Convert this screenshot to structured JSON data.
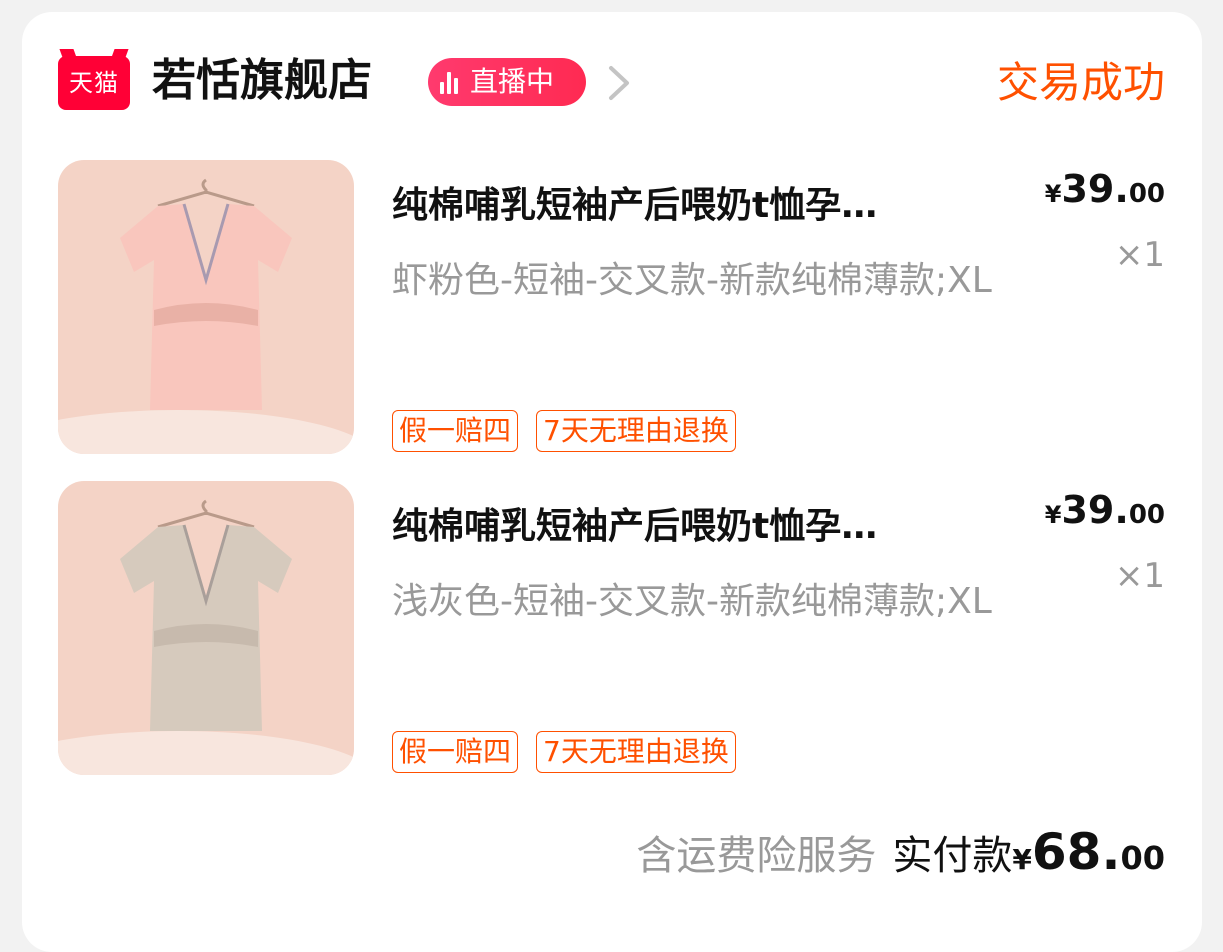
{
  "store": {
    "logo_text": "天猫",
    "name": "若恬旗舰店",
    "live_label": "直播中",
    "order_status": "交易成功"
  },
  "items": [
    {
      "title": "纯棉哺乳短袖产后喂奶t恤孕…",
      "spec": "虾粉色-短袖-交叉款-新款纯棉薄款;XL",
      "price_currency": "¥",
      "price_int": "39.",
      "price_dec": "00",
      "quantity": "×1",
      "tags": [
        "假一赔四",
        "7天无理由退换"
      ],
      "color": "#f9c6bd"
    },
    {
      "title": "纯棉哺乳短袖产后喂奶t恤孕…",
      "spec": "浅灰色-短袖-交叉款-新款纯棉薄款;XL",
      "price_currency": "¥",
      "price_int": "39.",
      "price_dec": "00",
      "quantity": "×1",
      "tags": [
        "假一赔四",
        "7天无理由退换"
      ],
      "color": "#d6cabd"
    }
  ],
  "footer": {
    "note": "含运费险服务",
    "paid_label": "实付款",
    "currency": "¥",
    "amount_int": "68.",
    "amount_dec": "00"
  },
  "colors": {
    "accent": "#ff5000",
    "tmall_red": "#ff0036",
    "live_pink": "#ff2a52"
  }
}
